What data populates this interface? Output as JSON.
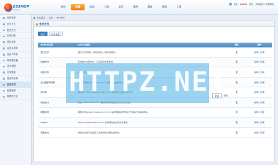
{
  "logo": {
    "title": "ESSHOP",
    "subtitle": "ecshop"
  },
  "topnav": [
    "首页",
    "设置",
    "商品",
    "订单",
    "会员",
    "推荐",
    "模板",
    "数据",
    "工具"
  ],
  "topnav_active": 1,
  "userbar": {
    "greeting": "您好",
    "username": "admin",
    "logout": "退出",
    "links": "清除缓存 | 查看网店"
  },
  "sidebar": [
    "系统设置",
    "支付方式",
    "配送方式",
    "区域列表",
    "地区设置",
    "会员注册项",
    "自定义导航",
    "邮件服务器",
    "站点地图",
    "友情链接",
    "验证码设置",
    "支付方式",
    "权限管理",
    "管理员日志"
  ],
  "sidebar_active": 11,
  "breadcrumb": [
    "后台首页",
    "设置",
    "支付方式"
  ],
  "panel": {
    "title": "支付方式"
  },
  "tabs": [
    "支付",
    "支付设置"
  ],
  "table": {
    "headers": [
      "支付方式名称",
      "支付方式描述",
      "插件",
      "操作"
    ],
    "rows": [
      {
        "name": "银行汇款",
        "desc": "银行汇款/转帐，请将款项汇入我们的账户。",
        "plugin": "否",
        "ops": "编辑 | 卸载"
      },
      {
        "name": "余额支付",
        "desc": "使用帐户余额支付，只有会员才能使用。",
        "plugin": "否",
        "ops": "编辑 | 卸载"
      },
      {
        "name": "货到付款",
        "desc": "货到付款，商品送达后付款。",
        "plugin": "否",
        "ops": "编辑 | 卸载"
      },
      {
        "name": "支付宝即时到账",
        "desc": "支付宝网站(www.alipay.com) 是国内先进的网上支付平台。",
        "plugin": "否",
        "ops": "编辑 | 卸载"
      },
      {
        "name": "财付通",
        "desc": "财付通 (https://www.tenpay.com) 腾讯旗下在线支付平台。",
        "plugin": "否",
        "ops": "编辑 | 卸载"
      },
      {
        "name": "快钱支付",
        "desc": "快钱 (www.99bill.com) 国内领先的独立第三方支付企业。",
        "plugin": "否",
        "ops": "编辑 | 卸载"
      },
      {
        "name": "网银在线",
        "desc": "网银在线(www.chinabank.com.cn)是中国领先的电子支付解决方案提供商。",
        "plugin": "否",
        "ops": "编辑 | 卸载"
      },
      {
        "name": "PayPal",
        "desc": "PayPal (www.paypal.com) 全球领先的在线支付服务。",
        "plugin": "否",
        "ops": "编辑 | 卸载"
      },
      {
        "name": "易宝支付",
        "desc": "易宝支付是专业的第三方在线支付服务提供商。",
        "plugin": "否",
        "ops": "编辑 | 卸载"
      }
    ]
  },
  "watermark": "HTTPZ.NET",
  "float_buttons": {
    "primary": "安装",
    "secondary": "卸载"
  }
}
